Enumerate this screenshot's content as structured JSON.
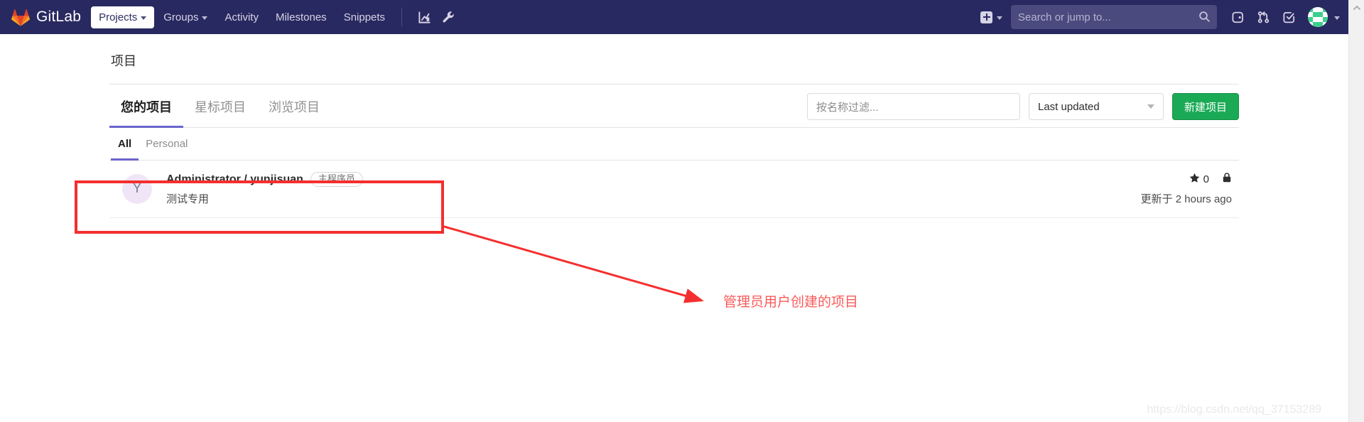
{
  "navbar": {
    "brand": "GitLab",
    "brand_icon": "gitlab-fox-logo",
    "bg_color": "#292961",
    "items": [
      {
        "label": "Projects",
        "icon": "chevron-down-icon",
        "active": true
      },
      {
        "label": "Groups",
        "icon": "chevron-down-icon",
        "active": false
      },
      {
        "label": "Activity",
        "icon": "",
        "active": false
      },
      {
        "label": "Milestones",
        "icon": "",
        "active": false
      },
      {
        "label": "Snippets",
        "icon": "",
        "active": false
      }
    ],
    "left_icons": [
      {
        "name": "analytics-chart-icon"
      },
      {
        "name": "wrench-admin-icon"
      }
    ],
    "create_new": {
      "icon": "plus-square-icon",
      "caret": "chevron-down-icon"
    },
    "search": {
      "placeholder": "Search or jump to...",
      "icon": "search-icon"
    },
    "right_icons": [
      {
        "name": "issues-icon"
      },
      {
        "name": "merge-requests-icon"
      },
      {
        "name": "todos-icon"
      }
    ],
    "avatar": {
      "name": "user-avatar",
      "caret": "chevron-down-icon"
    }
  },
  "scrollbar": {
    "up_arrow": "chevron-up-icon"
  },
  "page": {
    "title": "项目"
  },
  "tabs": [
    {
      "label": "您的项目",
      "active": true
    },
    {
      "label": "星标项目",
      "active": false
    },
    {
      "label": "浏览项目",
      "active": false
    }
  ],
  "toolbar": {
    "filter_placeholder": "按名称过滤...",
    "sort_value": "Last updated",
    "sort_caret": "chevron-down-icon",
    "new_project_label": "新建项目",
    "new_project_color": "#1aaa55"
  },
  "subtabs": [
    {
      "label": "All",
      "active": true
    },
    {
      "label": "Personal",
      "active": false
    }
  ],
  "projects": [
    {
      "avatar_letter": "Y",
      "avatar_bg": "#f0e5f7",
      "name": "Administrator / yunjisuan",
      "badge": "主程序员",
      "description": "测试专用",
      "star_icon": "star-icon",
      "stars": "0",
      "visibility_icon": "lock-icon",
      "updated": "更新于 2 hours ago"
    }
  ],
  "annotations": {
    "box_color": "#f42f2f",
    "arrow_color": "#f42f2f",
    "text": "管理员用户创建的项目",
    "text_color": "#fa5a5a"
  },
  "watermark": "https://blog.csdn.net/qq_37153289"
}
